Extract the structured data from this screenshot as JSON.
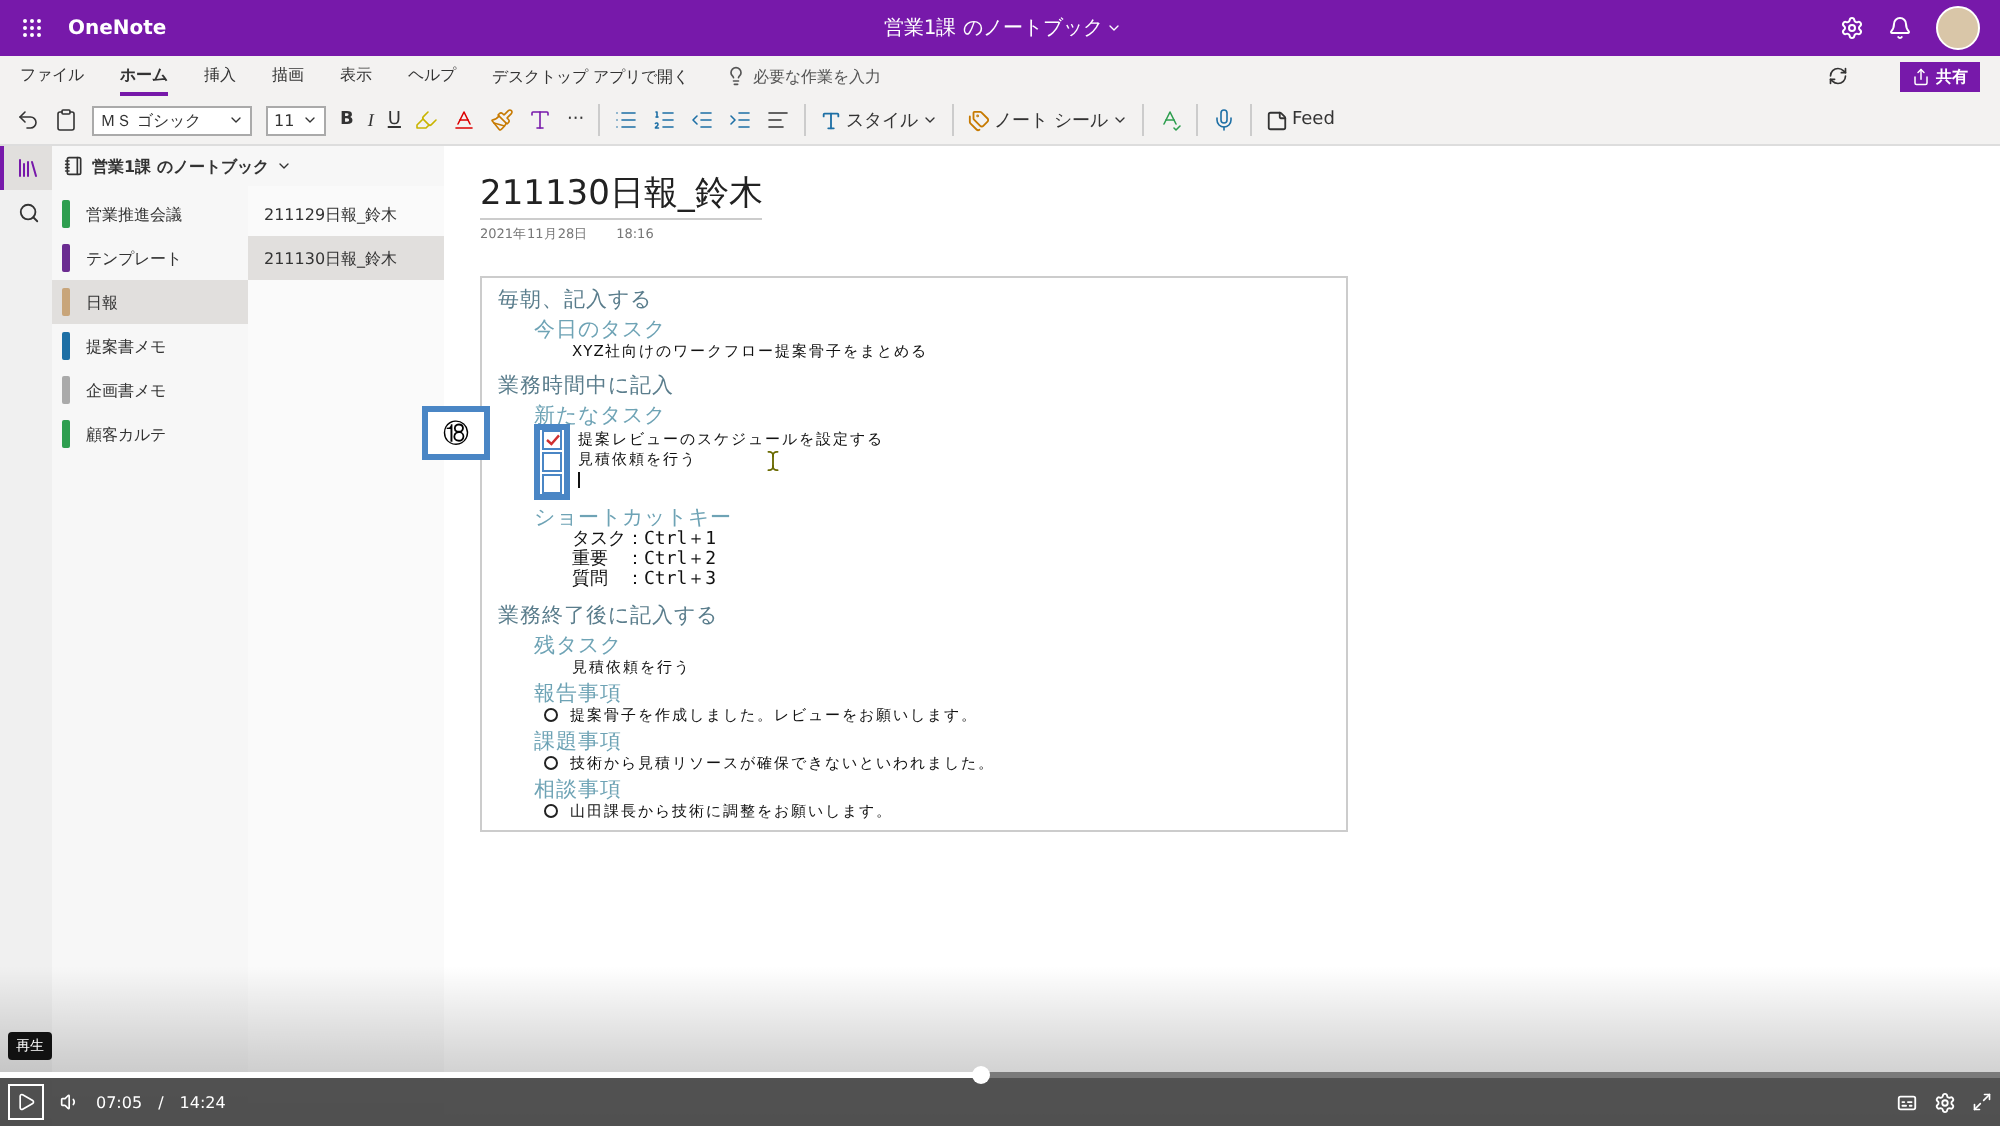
{
  "app_bar": {
    "app_name": "OneNote",
    "title": "営業1課 のノートブック"
  },
  "menu_tabs": [
    {
      "label": "ファイル",
      "selected": false
    },
    {
      "label": "ホーム",
      "selected": true
    },
    {
      "label": "挿入",
      "selected": false
    },
    {
      "label": "描画",
      "selected": false
    },
    {
      "label": "表示",
      "selected": false
    },
    {
      "label": "ヘルプ",
      "selected": false
    }
  ],
  "open_desktop": "デスクトップ アプリで開く",
  "tell_me": {
    "placeholder": "必要な作業を入力"
  },
  "share_button": "共有",
  "toolbar": {
    "font": "ＭＳ ゴシック",
    "size": "11",
    "bold": "B",
    "italic": "I",
    "underline": "U",
    "more": "···",
    "styles": "スタイル",
    "tags": "ノート シール",
    "feed": "Feed"
  },
  "notebook": {
    "name": "営業1課 のノートブック"
  },
  "sections": [
    {
      "label": "営業推進会議",
      "color": "#2e9e4f",
      "selected": false
    },
    {
      "label": "テンプレート",
      "color": "#6b2c91",
      "selected": false
    },
    {
      "label": "日報",
      "color": "#c8a57a",
      "selected": true
    },
    {
      "label": "提案書メモ",
      "color": "#1d6fa5",
      "selected": false
    },
    {
      "label": "企画書メモ",
      "color": "#aaaaaa",
      "selected": false
    },
    {
      "label": "顧客カルテ",
      "color": "#2e9e4f",
      "selected": false
    }
  ],
  "pages": [
    {
      "label": "211129日報_鈴木",
      "selected": false
    },
    {
      "label": "211130日報_鈴木",
      "selected": true
    }
  ],
  "page": {
    "title": "211130日報_鈴木",
    "date": "2021年11月28日",
    "time": "18:16",
    "outline": [
      {
        "kind": "h1",
        "text": "毎朝、記入する"
      },
      {
        "kind": "h2",
        "text": "今日のタスク"
      },
      {
        "kind": "text",
        "text": "XYZ社向けのワークフロー提案骨子をまとめる"
      },
      {
        "kind": "h1",
        "text": "業務時間中に記入"
      },
      {
        "kind": "h2",
        "text": "新たなタスク"
      },
      {
        "kind": "todo",
        "text": "提案レビューのスケジュールを設定する",
        "checked": true
      },
      {
        "kind": "todo",
        "text": "見積依頼を行う",
        "checked": false
      },
      {
        "kind": "todo",
        "checked": false
      },
      {
        "kind": "h2",
        "text": "ショートカットキー"
      },
      {
        "kind": "shortcut",
        "text": "タスク：Ctrl＋1"
      },
      {
        "kind": "shortcut",
        "text": "重要　：Ctrl＋2"
      },
      {
        "kind": "shortcut",
        "text": "質問　：Ctrl＋3"
      },
      {
        "kind": "h1",
        "text": "業務終了後に記入する"
      },
      {
        "kind": "h2",
        "text": "残タスク"
      },
      {
        "kind": "text",
        "text": "見積依頼を行う"
      },
      {
        "kind": "h2",
        "text": "報告事項"
      },
      {
        "kind": "bullet",
        "text": "提案骨子を作成しました。レビューをお願いします。"
      },
      {
        "kind": "h2",
        "text": "課題事項"
      },
      {
        "kind": "bullet",
        "text": "技術から見積リソースが確保できないといわれました。"
      },
      {
        "kind": "h2",
        "text": "相談事項"
      },
      {
        "kind": "bullet",
        "text": "山田課長から技術に調整をお願いします。"
      }
    ]
  },
  "callout": {
    "label": "⑱"
  },
  "player": {
    "tooltip": "再生",
    "current": "07:05",
    "separator": "/",
    "duration": "14:24",
    "level": 0.49
  }
}
